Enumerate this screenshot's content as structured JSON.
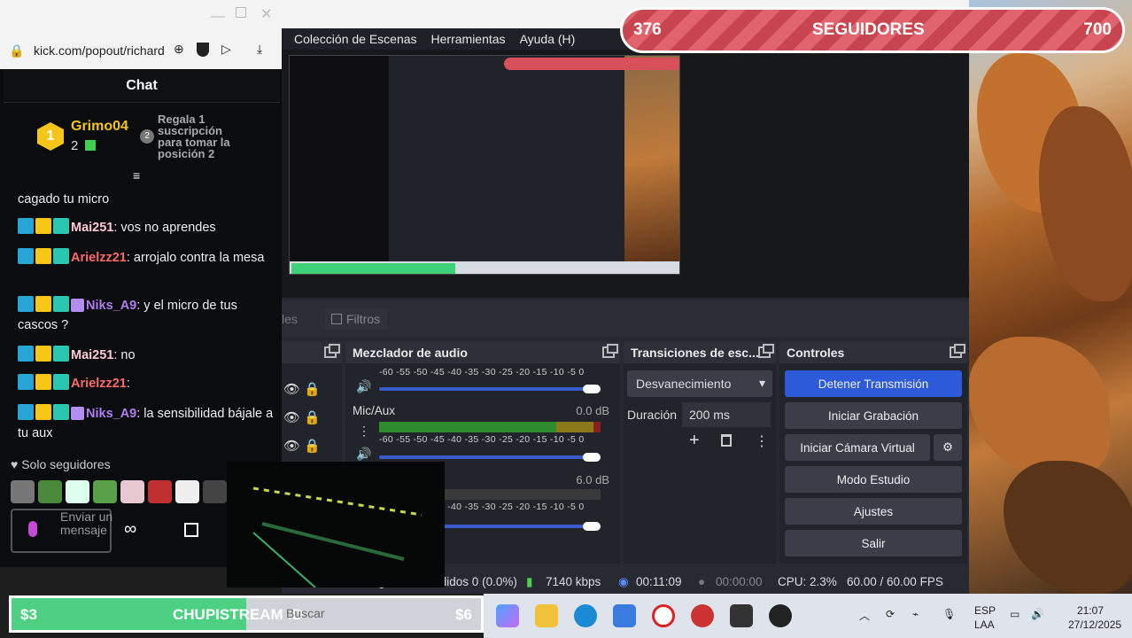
{
  "obs": {
    "menu": [
      "Colección de Escenas",
      "Herramientas",
      "Ayuda (H)"
    ],
    "tabs": {
      "scenes_partial": "les",
      "filters": "Filtros"
    },
    "audio_mixer": {
      "title": "Mezclador de audio",
      "scale_labels": "-60 -55 -50 -45 -40 -35 -30 -25 -20 -15 -10 -5 0",
      "channels": [
        {
          "name": "",
          "db": ""
        },
        {
          "name": "Mic/Aux",
          "db": "0.0 dB"
        },
        {
          "name": "",
          "db": "6.0 dB"
        }
      ]
    },
    "transitions": {
      "title": "Transiciones de esc...",
      "selected": "Desvanecimiento",
      "duration_label": "Duración",
      "duration_value": "200 ms"
    },
    "controls": {
      "title": "Controles",
      "buttons": [
        "Detener Transmisión",
        "Iniciar Grabación",
        "Iniciar Cámara Virtual",
        "Modo Estudio",
        "Ajustes",
        "Salir"
      ]
    },
    "status": {
      "dropped": "Fotogramas Perdidos 0 (0.0%)",
      "bitrate": "7140 kbps",
      "stream_time": "00:11:09",
      "rec_time": "00:00:00",
      "cpu": "CPU: 2.3%",
      "fps": "60.00 / 60.00 FPS"
    }
  },
  "chat": {
    "url": "kick.com/popout/richard",
    "title": "Chat",
    "leader": {
      "rank": "1",
      "name": "Grimo04",
      "count": "2"
    },
    "leader2": {
      "rank": "2",
      "text": "Regala 1 suscripción para tomar la posición 2"
    },
    "messages": [
      {
        "user": "",
        "color": "#ffffff",
        "text": "cagado tu micro",
        "badges": 0
      },
      {
        "user": "Mai251",
        "color": "#ffc9d4",
        "text": ": vos no aprendes",
        "badges": 3
      },
      {
        "user": "Arielzz21",
        "color": "#ff6a6a",
        "text": ": arrojalo contra la mesa",
        "badges": 3
      },
      {
        "user": "Niks_A9",
        "color": "#b07ef0",
        "text": ": y el micro de tus cascos ?",
        "badges": 4
      },
      {
        "user": "Mai251",
        "color": "#ffc9d4",
        "text": ": no",
        "badges": 3
      },
      {
        "user": "Arielzz21",
        "color": "#ff6a6a",
        "text": ":",
        "badges": 3
      },
      {
        "user": "Niks_A9",
        "color": "#b07ef0",
        "text": ": la sensibilidad bájale a tu aux",
        "badges": 4
      }
    ],
    "followers_only": "Solo seguidores",
    "input_placeholder": "Enviar un mensaje"
  },
  "follower_goal": {
    "current": "376",
    "label": "SEGUIDORES",
    "target": "700"
  },
  "sub_goal": {
    "left": "$3",
    "label": "CHUPISTREAM :D",
    "right": "$6",
    "search": "Buscar"
  },
  "taskbar": {
    "lang_top": "ESP",
    "lang_bottom": "LAA",
    "time": "21:07",
    "date": "27/12/2025"
  },
  "colors": {
    "accent": "#2c5ad8",
    "goal_green": "#4ed082",
    "follow_red": "#d85a63"
  }
}
